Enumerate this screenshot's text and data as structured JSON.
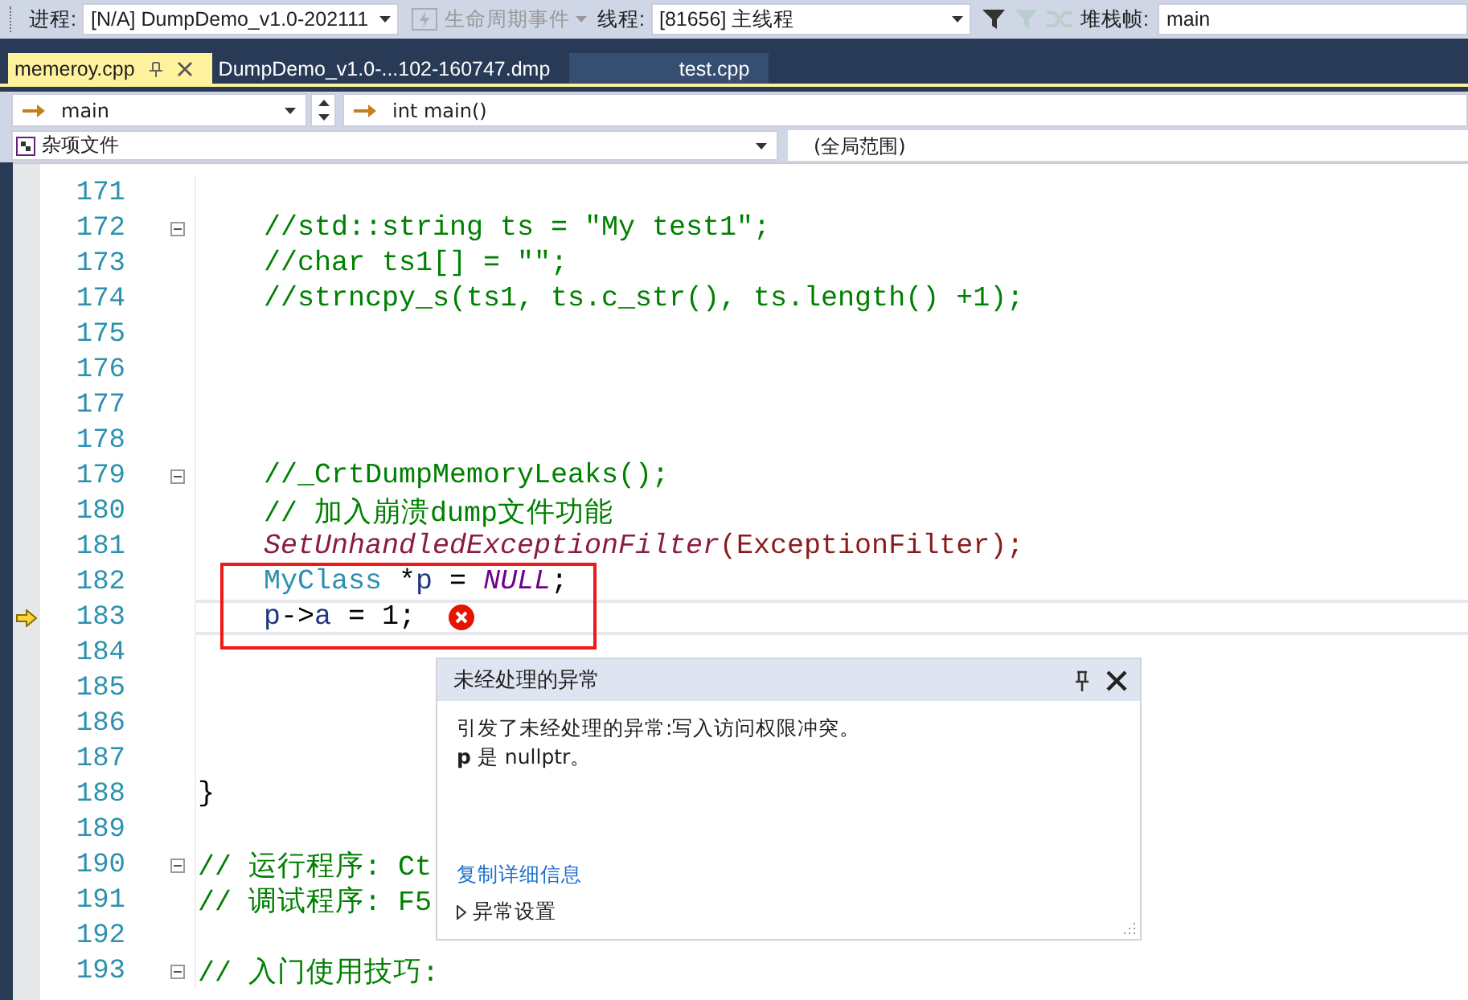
{
  "toolbar": {
    "process_label": "进程:",
    "process": "[N/A] DumpDemo_v1.0-202111",
    "lifecycle": "生命周期事件",
    "thread_label": "线程:",
    "thread": "[81656] 主线程",
    "stack_label": "堆栈帧:",
    "stack": "main"
  },
  "tabs": [
    {
      "label": "memeroy.cpp",
      "selected": true
    },
    {
      "label": "DumpDemo_v1.0-...102-160747.dmp",
      "selected": false
    },
    {
      "label": "test.cpp",
      "selected": false
    }
  ],
  "nav": {
    "scope": "main",
    "function": "int main()",
    "project": "杂项文件",
    "global_scope": "(全局范围)"
  },
  "lines": [
    {
      "number": "171",
      "fold": false,
      "current": false,
      "error": false
    },
    {
      "number": "172",
      "fold": true,
      "indented": true,
      "current": false,
      "error": false,
      "segments": [
        {
          "kind": "comment",
          "text": "//std::string ts = \"My test1\";"
        }
      ]
    },
    {
      "number": "173",
      "fold": false,
      "indented": true,
      "current": false,
      "error": false,
      "segments": [
        {
          "kind": "comment",
          "text": "//char ts1[] = \"\";"
        }
      ]
    },
    {
      "number": "174",
      "fold": false,
      "indented": true,
      "current": false,
      "error": false,
      "segments": [
        {
          "kind": "comment",
          "text": "//strncpy_s(ts1, ts.c_str(), ts.length() +1);"
        }
      ]
    },
    {
      "number": "175",
      "fold": false,
      "current": false,
      "error": false
    },
    {
      "number": "176",
      "fold": false,
      "current": false,
      "error": false
    },
    {
      "number": "177",
      "fold": false,
      "current": false,
      "error": false
    },
    {
      "number": "178",
      "fold": false,
      "current": false,
      "error": false
    },
    {
      "number": "179",
      "fold": true,
      "indented": true,
      "current": false,
      "error": false,
      "segments": [
        {
          "kind": "comment",
          "text": "//_CrtDumpMemoryLeaks();"
        }
      ]
    },
    {
      "number": "180",
      "fold": false,
      "indented": true,
      "current": false,
      "error": false,
      "segments": [
        {
          "kind": "comment",
          "text": "// 加入崩溃dump文件功能"
        }
      ]
    },
    {
      "number": "181",
      "fold": false,
      "indented": true,
      "current": false,
      "error": false,
      "segments": [
        {
          "kind": "macro",
          "text": "SetUnhandledExceptionFilter"
        },
        {
          "kind": "argument",
          "text": "(ExceptionFilter);"
        }
      ]
    },
    {
      "number": "182",
      "fold": false,
      "indented": true,
      "current": false,
      "error": false,
      "segments": [
        {
          "kind": "type",
          "text": "MyClass"
        },
        {
          "kind": "plain",
          "text": " *"
        },
        {
          "kind": "variable",
          "text": "p"
        },
        {
          "kind": "plain",
          "text": " = "
        },
        {
          "kind": "macro_value",
          "text": "NULL"
        },
        {
          "kind": "plain",
          "text": ";"
        }
      ]
    },
    {
      "number": "183",
      "fold": false,
      "indented": true,
      "current": true,
      "error": true,
      "segments": [
        {
          "kind": "variable",
          "text": "p"
        },
        {
          "kind": "plain",
          "text": "->"
        },
        {
          "kind": "variable",
          "text": "a"
        },
        {
          "kind": "plain",
          "text": " = 1;"
        }
      ]
    },
    {
      "number": "184",
      "fold": false,
      "current": false,
      "error": false
    },
    {
      "number": "185",
      "fold": false,
      "current": false,
      "error": false
    },
    {
      "number": "186",
      "fold": false,
      "current": false,
      "error": false
    },
    {
      "number": "187",
      "fold": false,
      "current": false,
      "error": false
    },
    {
      "number": "188",
      "fold": false,
      "indented": false,
      "current": false,
      "error": false,
      "segments": [
        {
          "kind": "plain",
          "text": "}"
        }
      ]
    },
    {
      "number": "189",
      "fold": false,
      "current": false,
      "error": false
    },
    {
      "number": "190",
      "fold": true,
      "indented": false,
      "current": false,
      "error": false,
      "segments": [
        {
          "kind": "comment",
          "text": "// 运行程序: Ct"
        }
      ]
    },
    {
      "number": "191",
      "fold": false,
      "indented": false,
      "current": false,
      "segments": [
        {
          "kind": "comment",
          "text": "// 调试程序: F5"
        }
      ]
    },
    {
      "number": "192",
      "fold": false,
      "current": false,
      "error": false
    },
    {
      "number": "193",
      "fold": true,
      "indented": false,
      "current": false,
      "error": false,
      "segments": [
        {
          "kind": "comment",
          "text": "// 入门使用技巧:"
        }
      ]
    }
  ],
  "exception_popup": {
    "title": "未经处理的异常",
    "message": "引发了未经处理的异常:写入访问权限冲突。",
    "detail": "**p** 是 nullptr。",
    "link": "复制详细信息",
    "settings": "异常设置"
  }
}
